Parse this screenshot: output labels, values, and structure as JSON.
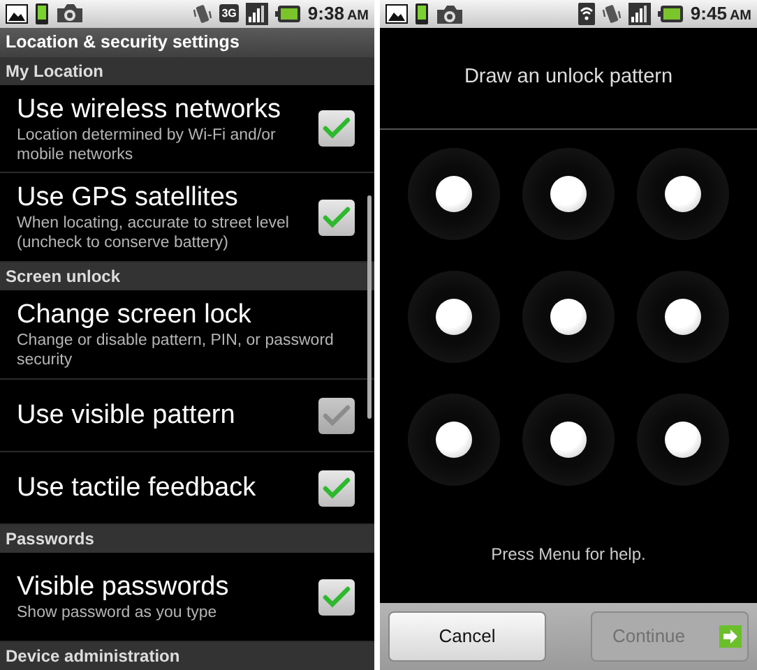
{
  "left_screen": {
    "status_bar": {
      "icons": [
        {
          "kind": "picture"
        },
        {
          "kind": "phone"
        },
        {
          "kind": "camera"
        },
        {
          "kind": "gap"
        },
        {
          "kind": "vibrate"
        },
        {
          "kind": "network",
          "label": "3G"
        },
        {
          "kind": "signal"
        },
        {
          "kind": "battery"
        }
      ],
      "time": "9:38",
      "ampm": "AM"
    },
    "title": "Location & security settings",
    "sections": [
      {
        "header": "My Location",
        "items": [
          {
            "kind": "checkbox",
            "title": "Use wireless networks",
            "summary": "Location determined by Wi-Fi and/or mobile networks",
            "checked": true,
            "disabled": false
          },
          {
            "kind": "checkbox",
            "title": "Use GPS satellites",
            "summary": "When locating, accurate to street level (uncheck to conserve battery)",
            "checked": true,
            "disabled": false
          }
        ]
      },
      {
        "header": "Screen unlock",
        "items": [
          {
            "kind": "link",
            "title": "Change screen lock",
            "summary": "Change or disable pattern, PIN, or password security"
          },
          {
            "kind": "checkbox",
            "title": "Use visible pattern",
            "checked": true,
            "disabled": true
          },
          {
            "kind": "checkbox",
            "title": "Use tactile feedback",
            "checked": true,
            "disabled": false
          }
        ]
      },
      {
        "header": "Passwords",
        "items": [
          {
            "kind": "checkbox",
            "title": "Visible passwords",
            "summary": "Show password as you type",
            "checked": true,
            "disabled": false
          }
        ]
      },
      {
        "header": "Device administration"
      }
    ]
  },
  "right_screen": {
    "status_bar": {
      "icons": [
        {
          "kind": "picture"
        },
        {
          "kind": "phone"
        },
        {
          "kind": "camera"
        },
        {
          "kind": "gap"
        },
        {
          "kind": "wifi"
        },
        {
          "kind": "vibrate"
        },
        {
          "kind": "signal"
        },
        {
          "kind": "battery"
        }
      ],
      "time": "9:45",
      "ampm": "AM"
    },
    "heading": "Draw an unlock pattern",
    "dots": [
      {
        "selected": false
      },
      {
        "selected": false
      },
      {
        "selected": false
      },
      {
        "selected": false
      },
      {
        "selected": false
      },
      {
        "selected": false
      },
      {
        "selected": false
      },
      {
        "selected": false
      },
      {
        "selected": false
      }
    ],
    "hint": "Press Menu for help.",
    "buttons": [
      {
        "label": "Cancel",
        "disabled": false,
        "kind": "plain"
      },
      {
        "label": "Continue",
        "disabled": true,
        "kind": "next"
      }
    ]
  }
}
